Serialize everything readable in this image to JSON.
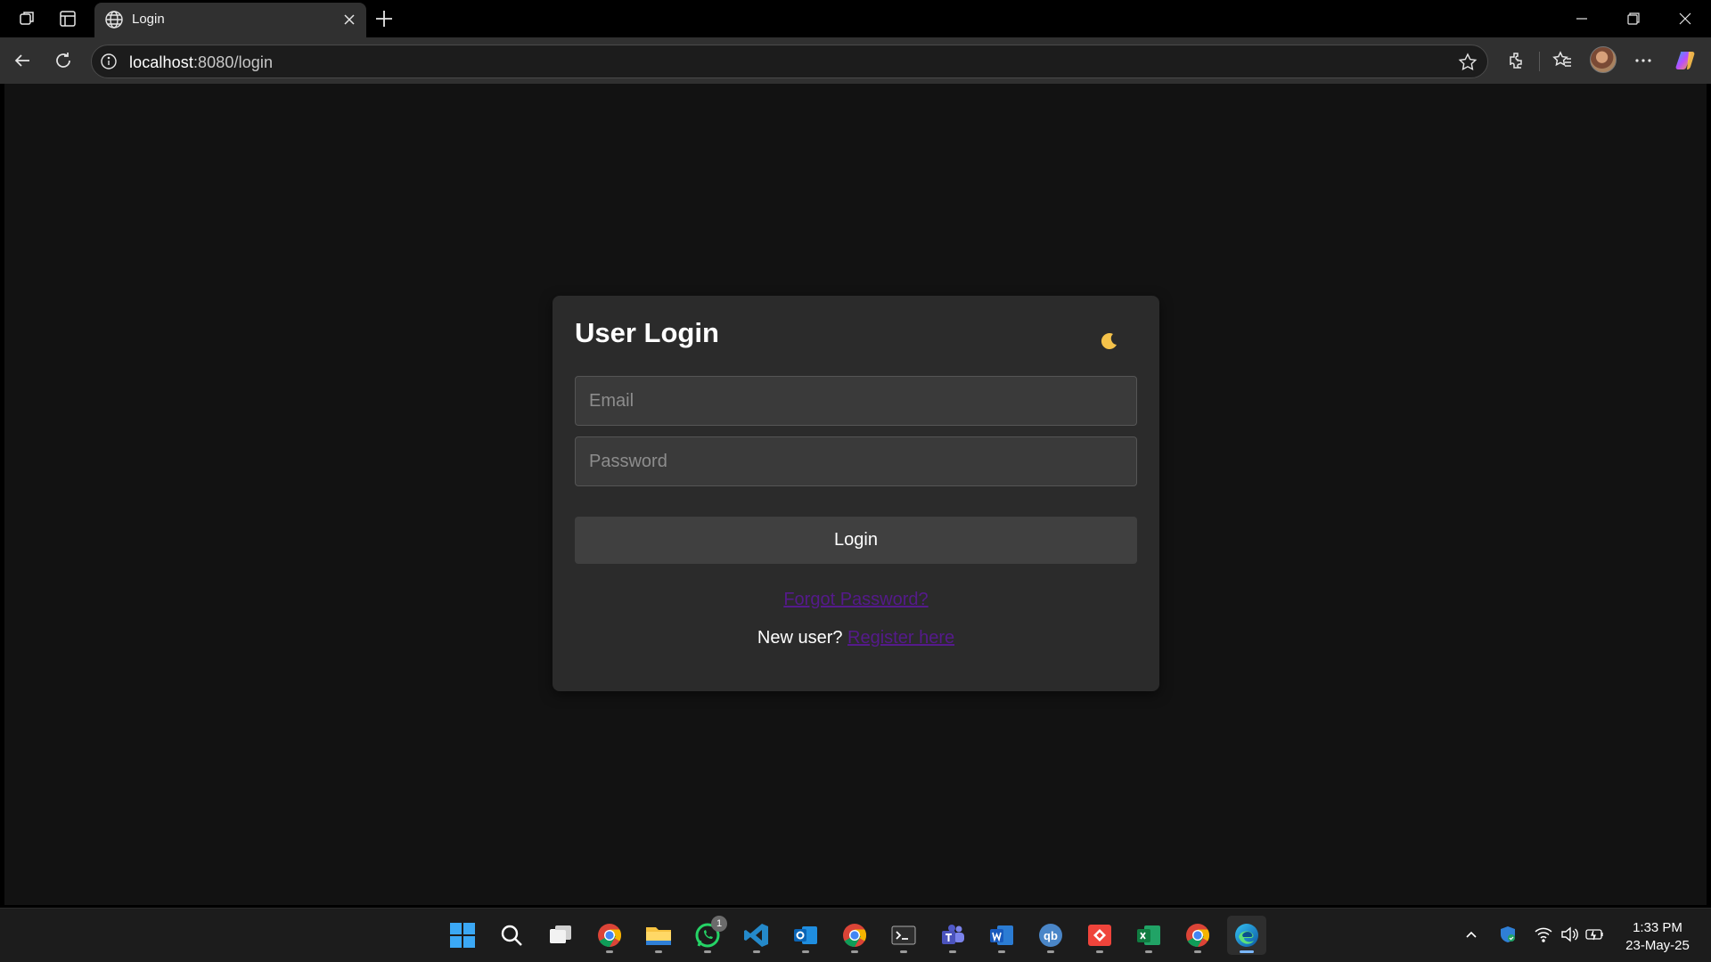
{
  "browser": {
    "tab_title": "Login",
    "url_host": "localhost",
    "url_path": ":8080/login"
  },
  "login_form": {
    "title": "User Login",
    "theme_toggle_icon": "moon-icon",
    "email_placeholder": "Email",
    "password_placeholder": "Password",
    "login_button": "Login",
    "forgot_password_link": "Forgot Password?",
    "new_user_text": "New user?",
    "register_link": "Register here",
    "link_color": "#551a8b"
  },
  "taskbar": {
    "apps": [
      "windows-start-icon",
      "search-icon",
      "task-view-icon",
      "chrome-icon",
      "file-explorer-icon",
      "whatsapp-icon",
      "vscode-icon",
      "outlook-icon",
      "chrome-icon",
      "terminal-icon",
      "teams-icon",
      "word-icon",
      "qbittorrent-icon",
      "anydesk-icon",
      "excel-icon",
      "chrome-icon",
      "edge-icon"
    ],
    "whatsapp_badge": "1",
    "time": "1:33 PM",
    "date": "23-May-25"
  }
}
